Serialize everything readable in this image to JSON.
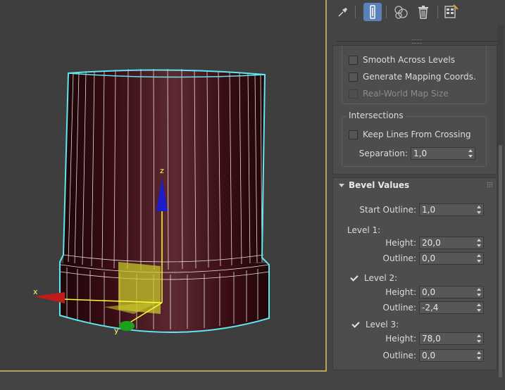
{
  "viewport": {
    "axes": {
      "x_label": "x",
      "y_label": "y",
      "z_label": "z"
    }
  },
  "toolbar": {
    "buttons": [
      {
        "icon": "pin-stack-icon",
        "active": false
      },
      {
        "icon": "show-end-result-icon",
        "active": true
      },
      {
        "icon": "make-unique-icon",
        "active": false
      },
      {
        "icon": "remove-modifier-icon",
        "active": false
      },
      {
        "icon": "configure-modifier-sets-icon",
        "active": false
      }
    ]
  },
  "surface_rollout": {
    "smooth_across_levels": {
      "label": "Smooth Across Levels",
      "checked": false
    },
    "generate_mapping_coords": {
      "label": "Generate Mapping Coords.",
      "checked": false
    },
    "real_world_map_size": {
      "label": "Real-World Map Size",
      "checked": false,
      "enabled": false
    }
  },
  "intersections": {
    "title": "Intersections",
    "keep_lines": {
      "label": "Keep Lines From Crossing",
      "checked": false
    },
    "separation": {
      "label": "Separation:",
      "value": "1,0"
    }
  },
  "bevel_values": {
    "title": "Bevel Values",
    "start_outline": {
      "label": "Start Outline:",
      "value": "1,0"
    },
    "level1": {
      "label": "Level 1:",
      "height": {
        "label": "Height:",
        "value": "20,0"
      },
      "outline": {
        "label": "Outline:",
        "value": "0,0"
      }
    },
    "level2": {
      "label": "Level 2:",
      "checked": true,
      "height": {
        "label": "Height:",
        "value": "0,0"
      },
      "outline": {
        "label": "Outline:",
        "value": "-2,4"
      }
    },
    "level3": {
      "label": "Level 3:",
      "checked": true,
      "height": {
        "label": "Height:",
        "value": "78,0"
      },
      "outline": {
        "label": "Outline:",
        "value": "0,0"
      }
    }
  },
  "colors": {
    "selection_outline": "#5fe6f0",
    "object_fill": "#3a0f16",
    "viewport_border": "#b8a35a",
    "active_button": "#5b82b8",
    "gizmo_yellow": "#ffff33"
  }
}
